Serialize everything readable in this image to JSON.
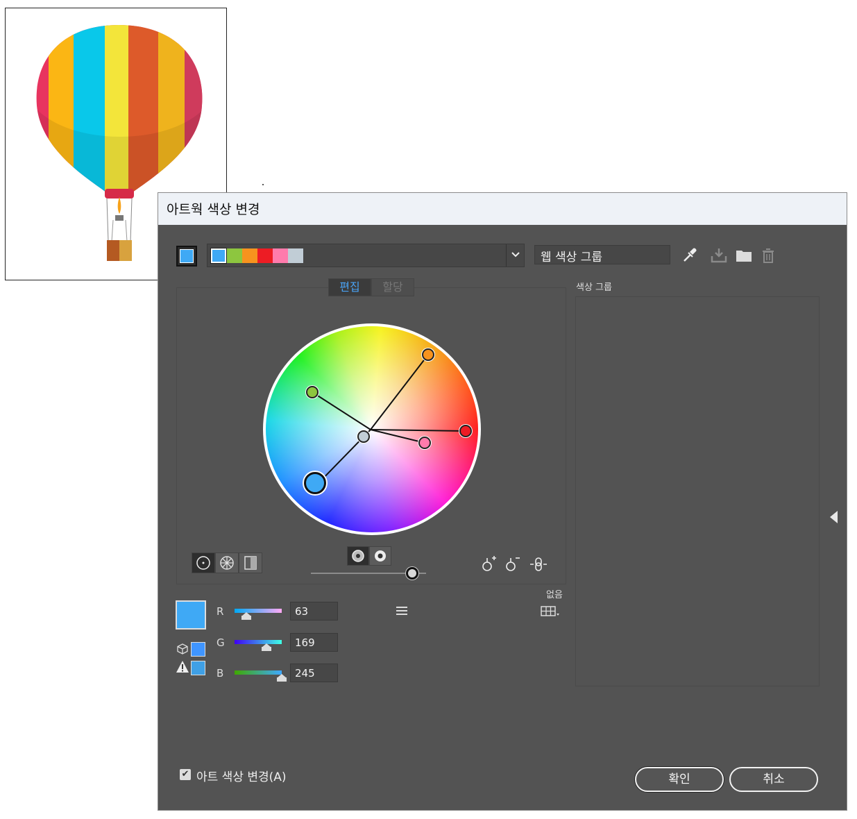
{
  "dialog": {
    "title": "아트웍 색상 변경",
    "group_name": "웹 색상 그룹",
    "tabs": [
      {
        "label": "편집",
        "active": true
      },
      {
        "label": "할당",
        "active": false
      }
    ],
    "color_groups_label": "색상 그룹",
    "none_label": "없음",
    "selected_color": "#3fa9f5",
    "swatches": [
      "#3fa9f5",
      "#8dc63f",
      "#f7931e",
      "#ed1c24",
      "#ff7bac",
      "#c1cdd6"
    ],
    "rgb": [
      {
        "label": "R",
        "value": "63"
      },
      {
        "label": "G",
        "value": "169"
      },
      {
        "label": "B",
        "value": "245"
      }
    ],
    "recolor_art_label": "아트 색상 변경(A)",
    "recolor_art_checked": true,
    "ok_label": "확인",
    "cancel_label": "취소",
    "icons": {
      "eyedropper": "eyedropper-icon",
      "save": "save-group-icon",
      "folder": "new-folder-icon",
      "trash": "trash-icon",
      "menu": "hamburger-menu-icon",
      "swatch_library": "swatch-library-icon"
    }
  }
}
